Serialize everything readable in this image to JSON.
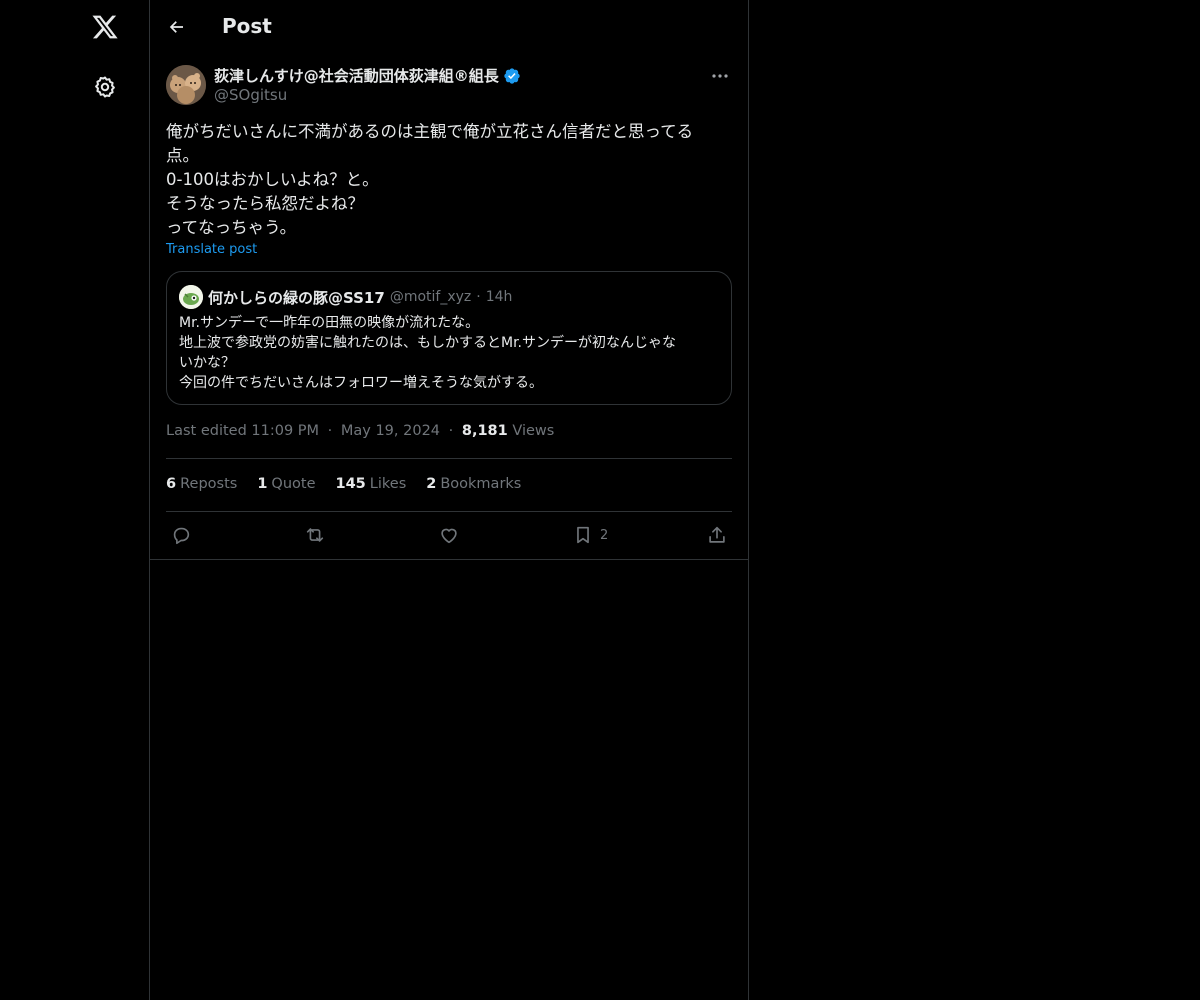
{
  "nav": {
    "logo_icon": "x-logo-icon",
    "settings_icon": "gear-icon"
  },
  "header": {
    "title": "Post",
    "back_icon": "arrow-left-icon"
  },
  "post": {
    "author_name": "荻津しんすけ@社会活動団体荻津組®組長",
    "author_handle": "@SOgitsu",
    "verified": true,
    "more_icon": "more-horizontal-icon",
    "text_lines": [
      "俺がちだいさんに不満があるのは主観で俺が立花さん信者だと思ってる",
      "点。",
      "0-100はおかしいよね？と。",
      "そうなったら私怨だよね？",
      "ってなっちゃう。"
    ],
    "translate_label": "Translate post",
    "quote": {
      "name": "何かしらの緑の豚@SS17",
      "handle": "@motif_xyz",
      "separator": "·",
      "time": "14h",
      "text_lines": [
        "Mr.サンデーで一昨年の田無の映像が流れたな。",
        "地上波で参政党の妨害に触れたのは、もしかするとMr.サンデーが初なんじゃな",
        "いかな？",
        "今回の件でちだいさんはフォロワー増えそうな気がする。"
      ]
    },
    "meta": {
      "edited_label": "Last edited 11:09 PM",
      "separator": "·",
      "date": "May 19, 2024",
      "views_count": "8,181",
      "views_label": "Views"
    },
    "stats": {
      "reposts_count": "6",
      "reposts_label": "Reposts",
      "quotes_count": "1",
      "quotes_label": "Quote",
      "likes_count": "145",
      "likes_label": "Likes",
      "bookmarks_count": "2",
      "bookmarks_label": "Bookmarks"
    },
    "actions": {
      "bookmark_count": "2"
    }
  },
  "colors": {
    "background": "#000000",
    "text": "#e7e9ea",
    "muted": "#71767b",
    "accent": "#1d9bf0",
    "border": "#2f3336"
  }
}
